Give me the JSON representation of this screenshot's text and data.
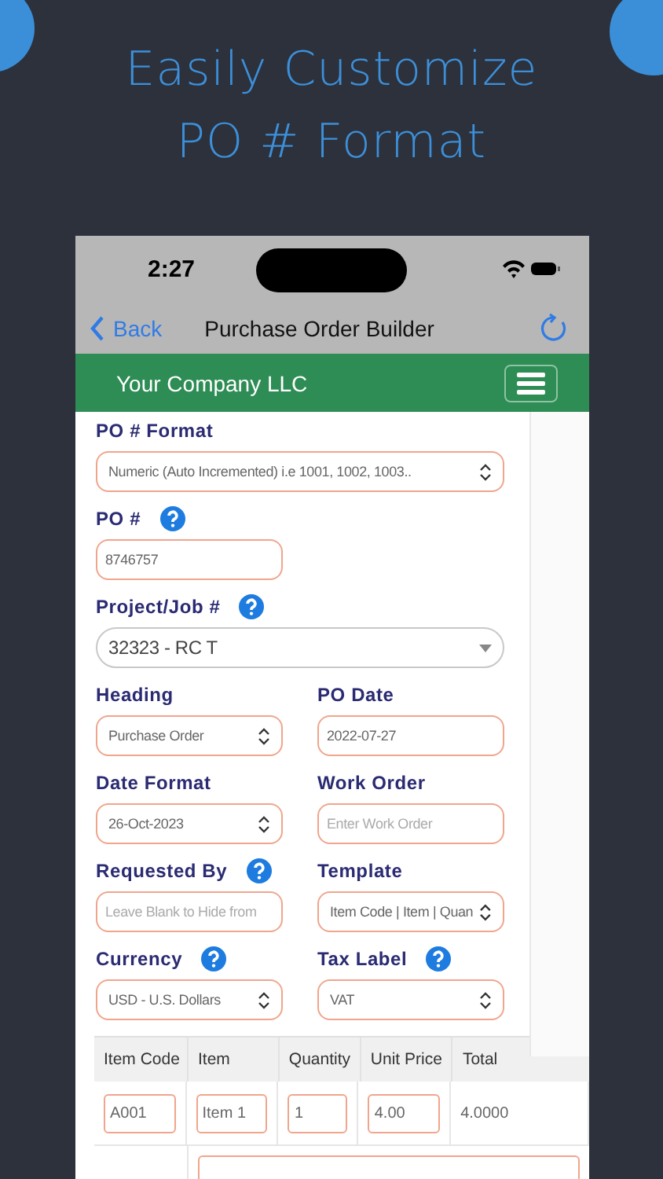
{
  "headline": {
    "lines": [
      "Easily Customize",
      "PO # Format"
    ]
  },
  "status_bar": {
    "time": "2:27"
  },
  "nav": {
    "back": "Back",
    "title": "Purchase Order Builder"
  },
  "app_bar": {
    "company": "Your Company LLC"
  },
  "form": {
    "rows": [
      {
        "fields": [
          {
            "label": "PO # Format",
            "help": false,
            "kind": "select",
            "value": "Numeric (Auto Incremented) i.e 1001, 1002, 1003.."
          }
        ]
      },
      {
        "fields": [
          {
            "label": "PO #",
            "help": true,
            "kind": "input",
            "value": "8746757"
          }
        ]
      },
      {
        "fields": [
          {
            "label": "Project/Job #",
            "help": true,
            "kind": "combo",
            "value": "32323 - RC T"
          }
        ]
      },
      {
        "fields": [
          {
            "label": "Heading",
            "help": false,
            "kind": "select",
            "value": "Purchase Order"
          },
          {
            "label": "PO Date",
            "help": false,
            "kind": "input",
            "value": "2022-07-27"
          }
        ]
      },
      {
        "fields": [
          {
            "label": "Date Format",
            "help": false,
            "kind": "select",
            "value": "26-Oct-2023"
          },
          {
            "label": "Work Order",
            "help": false,
            "kind": "input",
            "placeholder": "Enter Work Order"
          }
        ]
      },
      {
        "fields": [
          {
            "label": "Requested By",
            "help": true,
            "kind": "input",
            "placeholder": "Leave Blank to Hide from"
          },
          {
            "label": "Template",
            "help": false,
            "kind": "select",
            "value": "Item Code | Item | Quan"
          }
        ]
      },
      {
        "fields": [
          {
            "label": "Currency",
            "help": true,
            "kind": "select",
            "value": "USD - U.S. Dollars"
          },
          {
            "label": "Tax Label",
            "help": true,
            "kind": "select",
            "value": "VAT"
          }
        ]
      }
    ]
  },
  "table": {
    "columns": [
      "Item Code",
      "Item",
      "Quantity",
      "Unit Price",
      "Total"
    ],
    "rows": [
      {
        "cells": [
          {
            "kind": "input",
            "value": "A001"
          },
          {
            "kind": "input",
            "value": "Item 1"
          },
          {
            "kind": "input",
            "value": "1"
          },
          {
            "kind": "input",
            "value": "4.00"
          },
          {
            "kind": "text",
            "value": "4.0000"
          }
        ]
      },
      {
        "cells": [
          {
            "kind": "blank"
          },
          {
            "kind": "wide_input"
          }
        ]
      }
    ]
  }
}
